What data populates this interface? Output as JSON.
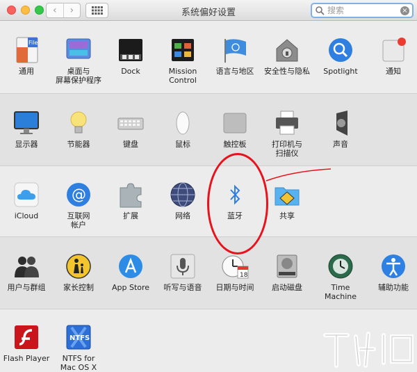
{
  "window": {
    "title": "系统偏好设置"
  },
  "toolbar": {
    "back_glyph": "‹",
    "forward_glyph": "›",
    "search_placeholder": "搜索",
    "clear_glyph": "×"
  },
  "sections": [
    {
      "items": [
        "通用",
        "桌面与屏幕保护程序",
        "Dock",
        "Mission Control",
        "语言与地区",
        "安全性与隐私",
        "Spotlight",
        "通知"
      ]
    },
    {
      "items": [
        "显示器",
        "节能器",
        "键盘",
        "鼠标",
        "触控板",
        "打印机与扫描仪",
        "声音"
      ]
    },
    {
      "items": [
        "iCloud",
        "互联网帐户",
        "扩展",
        "网络",
        "蓝牙",
        "共享"
      ]
    },
    {
      "items": [
        "用户与群组",
        "家长控制",
        "App Store",
        "听写与语音",
        "日期与时间",
        "启动磁盘",
        "Time Machine",
        "辅助功能"
      ]
    },
    {
      "items": [
        "Flash Player",
        "NTFS for Mac OS X"
      ]
    }
  ],
  "labels": {
    "general": "通用",
    "desktop_l1": "桌面与",
    "desktop_l2": "屏幕保护程序",
    "dock": "Dock",
    "mission_l1": "Mission",
    "mission_l2": "Control",
    "language": "语言与地区",
    "security": "安全性与隐私",
    "spotlight": "Spotlight",
    "notifications": "通知",
    "displays": "显示器",
    "energy": "节能器",
    "keyboard": "键盘",
    "mouse": "鼠标",
    "trackpad": "触控板",
    "printers_l1": "打印机与",
    "printers_l2": "扫描仪",
    "sound": "声音",
    "icloud": "iCloud",
    "internet_l1": "互联网",
    "internet_l2": "帐户",
    "extensions": "扩展",
    "network": "网络",
    "bluetooth": "蓝牙",
    "sharing": "共享",
    "users": "用户与群组",
    "parental": "家长控制",
    "appstore": "App Store",
    "dictation": "听写与语音",
    "datetime": "日期与时间",
    "startup": "启动磁盘",
    "timemachine": "Time Machine",
    "accessibility": "辅助功能",
    "flash": "Flash Player",
    "ntfs_l1": "NTFS for",
    "ntfs_l2": "Mac OS X"
  },
  "icon_text": {
    "file": "File",
    "new": "New",
    "ope": "Ope",
    "ntfs": "NTFS",
    "x": "X",
    "cal_month": "JUL",
    "cal_day": "18"
  },
  "colors": {
    "annotation_red": "#e8121c",
    "search_focus": "#7db1ea"
  }
}
